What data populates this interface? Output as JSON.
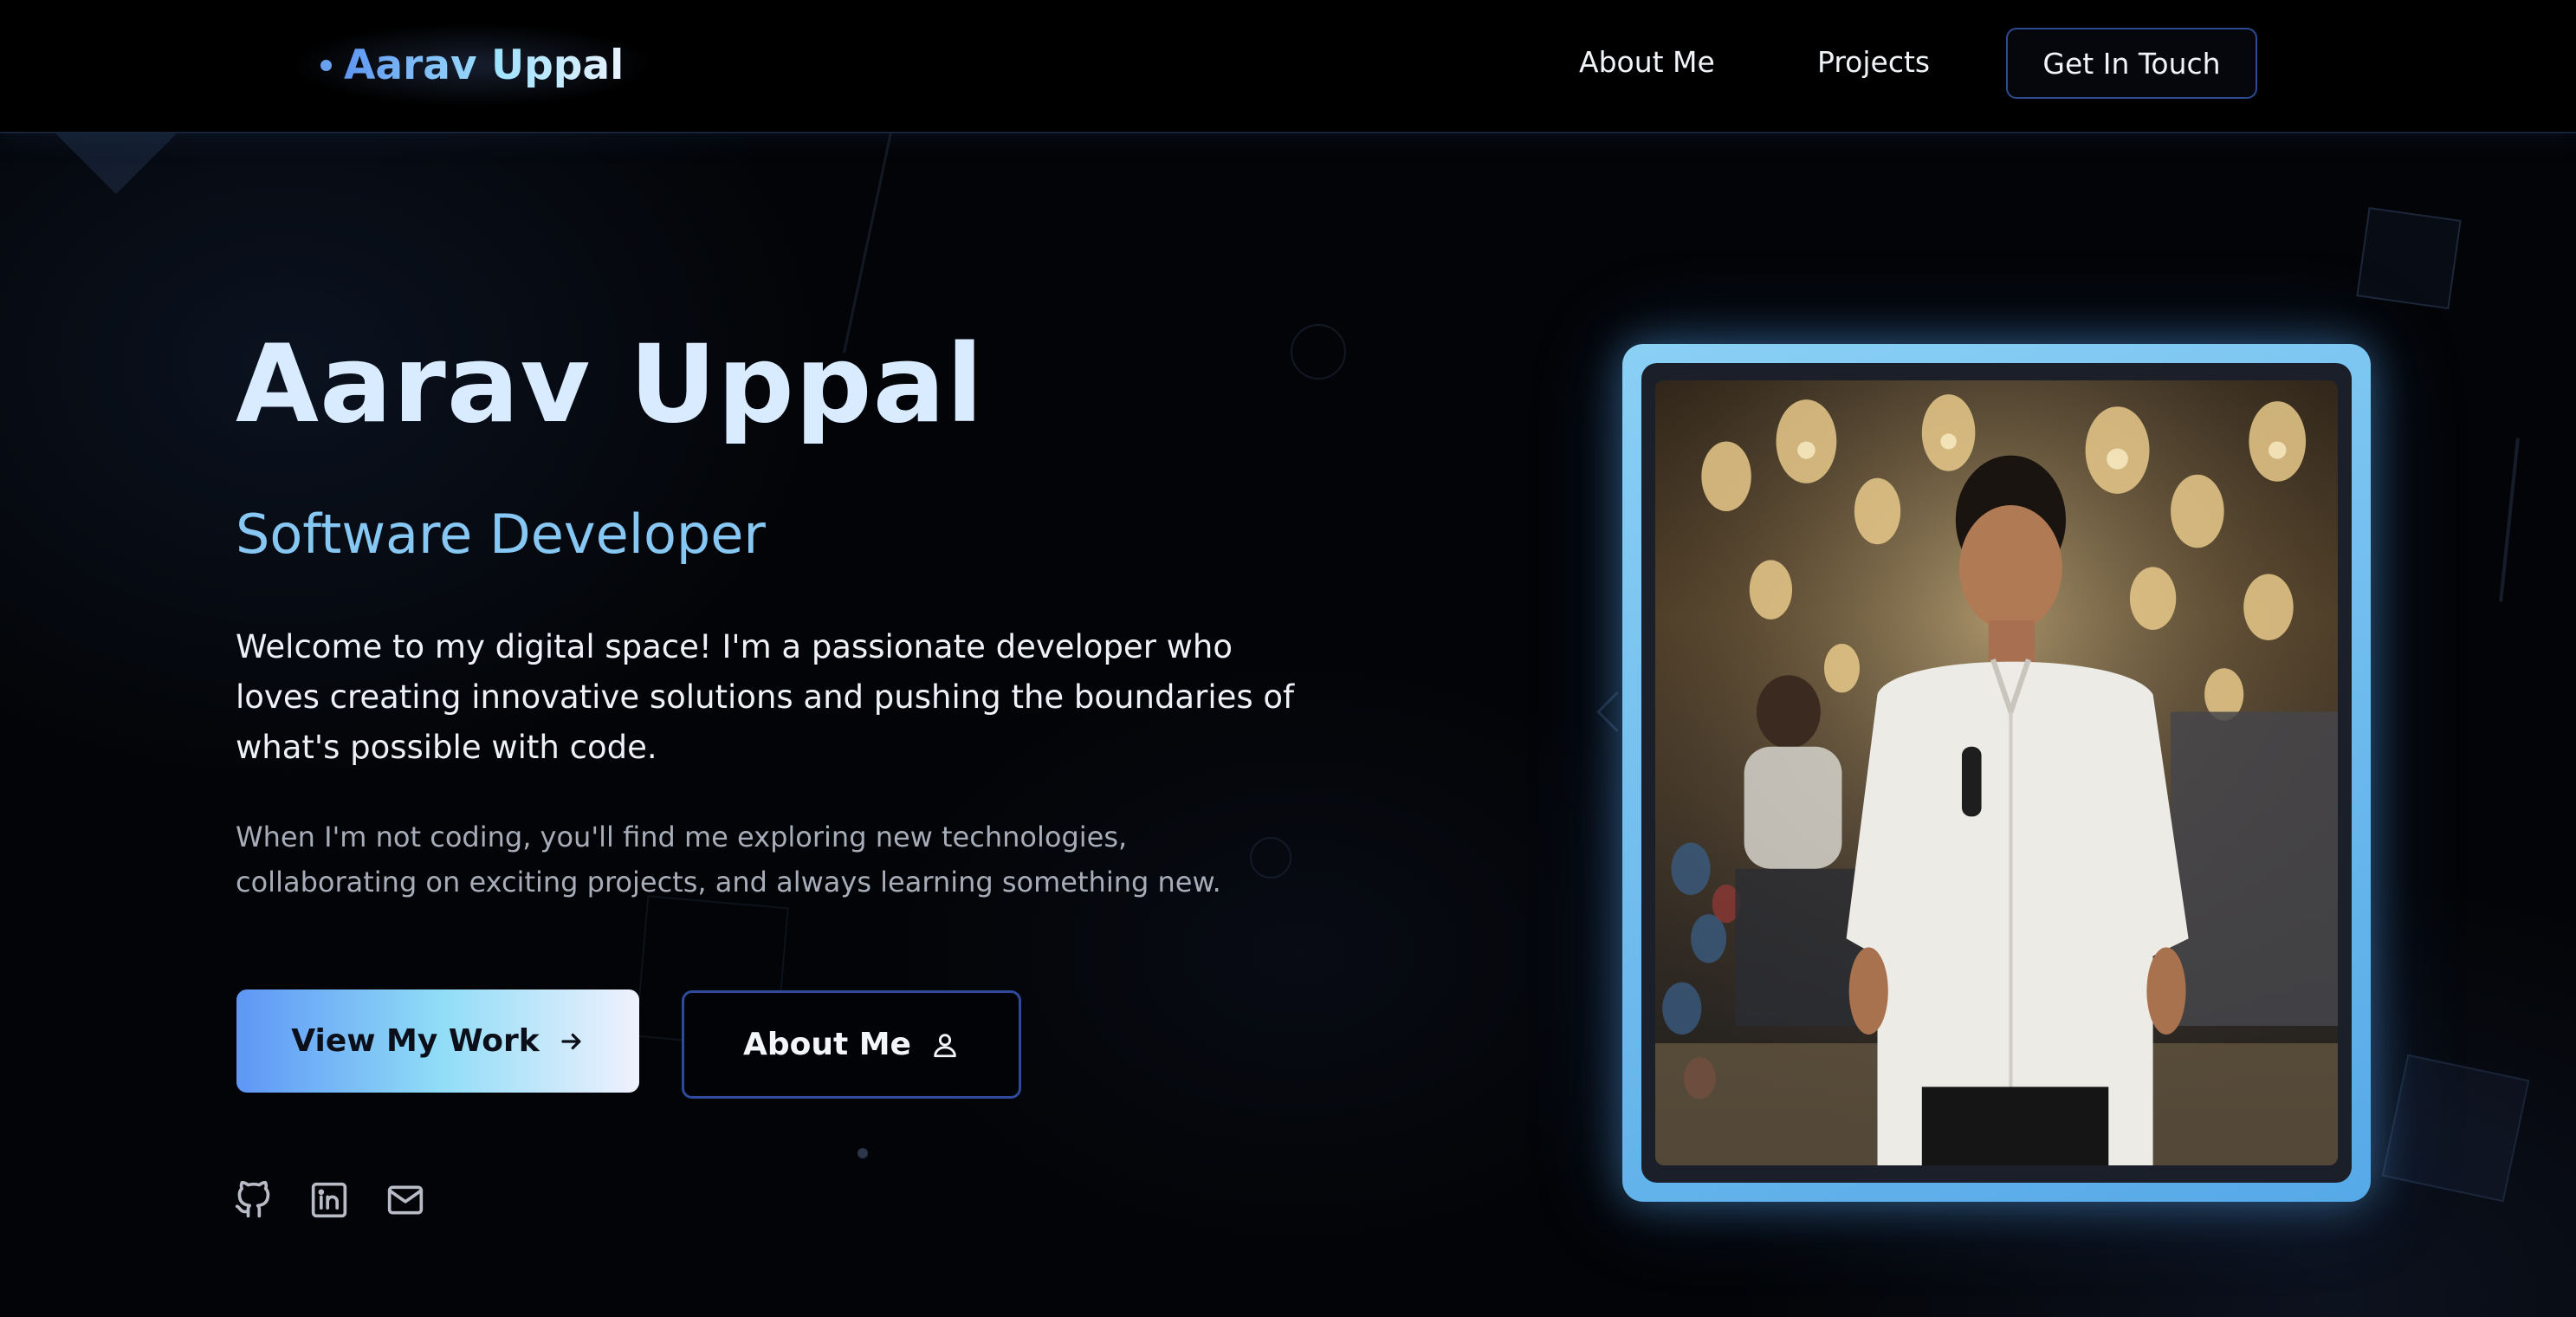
{
  "nav": {
    "brand": "Aarav Uppal",
    "links": [
      {
        "label": "About Me"
      },
      {
        "label": "Projects"
      }
    ],
    "cta": "Get In Touch"
  },
  "hero": {
    "name": "Aarav Uppal",
    "role": "Software Developer",
    "intro": "Welcome to my digital space! I'm a passionate developer who loves creating innovative solutions and pushing the boundaries of what's possible with code.",
    "sub": "When I'm not coding, you'll find me exploring new technologies, collaborating on exciting projects, and always learning something new.",
    "primary_button": "View My Work",
    "primary_icon": "arrow-right-icon",
    "secondary_button": "About Me",
    "secondary_icon": "user-icon"
  },
  "social": [
    {
      "icon": "github-icon"
    },
    {
      "icon": "linkedin-icon"
    },
    {
      "icon": "mail-icon"
    }
  ],
  "photo": {
    "subject": "portrait-photo"
  },
  "colors": {
    "background": "#030407",
    "accent_blue": "#5e96f5",
    "accent_cyan": "#8fdcf7",
    "title": "#d9ebff",
    "role": "#86c7f3",
    "button_border": "#2e4a9a"
  }
}
